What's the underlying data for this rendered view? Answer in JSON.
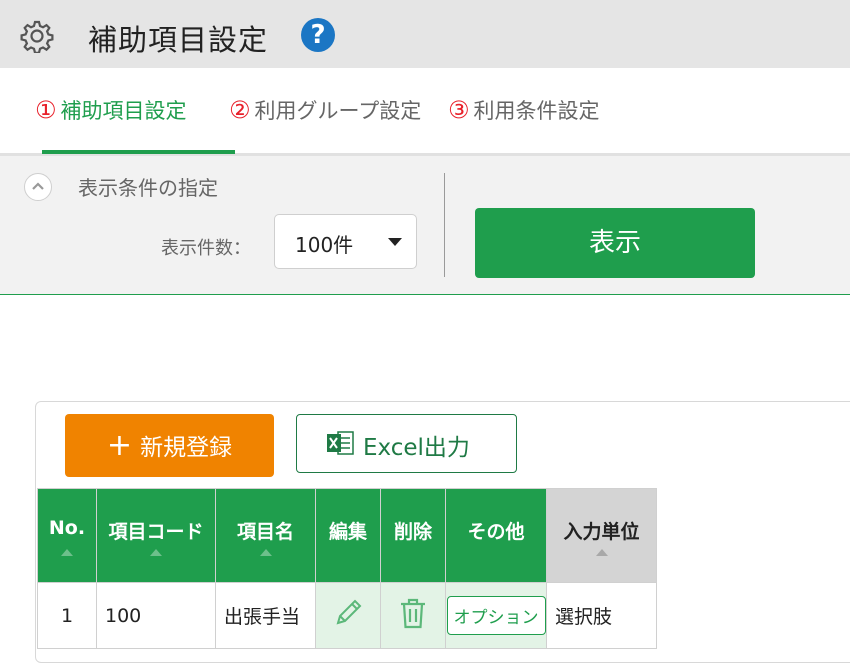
{
  "header": {
    "title": "補助項目設定",
    "help_label": "?"
  },
  "steps": [
    {
      "num": "①",
      "label": "補助項目設定",
      "active": true
    },
    {
      "num": "②",
      "label": "利用グループ設定",
      "active": false
    },
    {
      "num": "③",
      "label": "利用条件設定",
      "active": false
    }
  ],
  "filter": {
    "title": "表示条件の指定",
    "count_label": "表示件数：",
    "count_value": "100件",
    "show_button": "表示"
  },
  "actions": {
    "new_label": "新規登録",
    "new_icon": "+",
    "excel_label": "Excel出力"
  },
  "table": {
    "columns": [
      "No.",
      "項目コード",
      "項目名",
      "編集",
      "削除",
      "その他",
      "入力単位"
    ],
    "rows": [
      {
        "no": "1",
        "code": "100",
        "name": "出張手当",
        "option_label": "オプション",
        "unit": "選択肢"
      }
    ]
  },
  "colors": {
    "accent_green": "#1f9e4d",
    "new_button_orange": "#f08300",
    "step_number_red": "#e8202a",
    "help_blue": "#1b76c4"
  }
}
